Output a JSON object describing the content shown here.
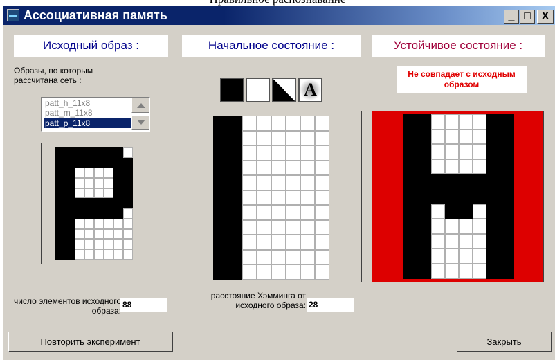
{
  "page_caption": "Правильное распознавание",
  "window": {
    "title": "Ассоциативная память",
    "minimize_label": "_",
    "maximize_label": "□",
    "close_label": "X"
  },
  "panels": {
    "source_title": "Исходный образ :",
    "initial_title": "Начальное состояние :",
    "stable_title": "Устойчивое состояние :"
  },
  "colors": {
    "panel_title_blue": "#00008b",
    "panel_title_red": "#a0003a",
    "warning_red": "#e00000",
    "stable_background": "#dd0000"
  },
  "training": {
    "label": "Образы, по которым рассчитана сеть :",
    "items": [
      "patt_h_11x8",
      "patt_m_11x8",
      "patt_p_11x8"
    ],
    "selected": "patt_p_11x8"
  },
  "state_buttons": [
    "fill-black-icon",
    "fill-white-icon",
    "diagonal-split-icon",
    "noise-letter-icon"
  ],
  "state_button_letter": "A",
  "stable_status": "Не совпадает с исходным образом",
  "stats": {
    "elements_label": "число элементов исходного образа:",
    "elements_value": "88",
    "hamming_label": "расстояние Хэмминга от исходного образа:",
    "hamming_value": "28"
  },
  "buttons": {
    "repeat": "Повторить эксперимент",
    "close": "Закрыть"
  },
  "patterns": {
    "rows": 11,
    "cols": 8,
    "source": [
      "11111110",
      "11111111",
      "11000011",
      "11000011",
      "11000011",
      "11111111",
      "11111110",
      "11000000",
      "11000000",
      "11000000",
      "11000000"
    ],
    "initial": [
      "11000000",
      "11000000",
      "11000000",
      "11000000",
      "11000000",
      "11000000",
      "11000000",
      "11000000",
      "11000000",
      "11000000",
      "11000000"
    ],
    "stable": [
      "11000011",
      "11000011",
      "11000011",
      "11000011",
      "11111111",
      "11111111",
      "11011011",
      "11000011",
      "11000011",
      "11000011",
      "11000011"
    ]
  }
}
